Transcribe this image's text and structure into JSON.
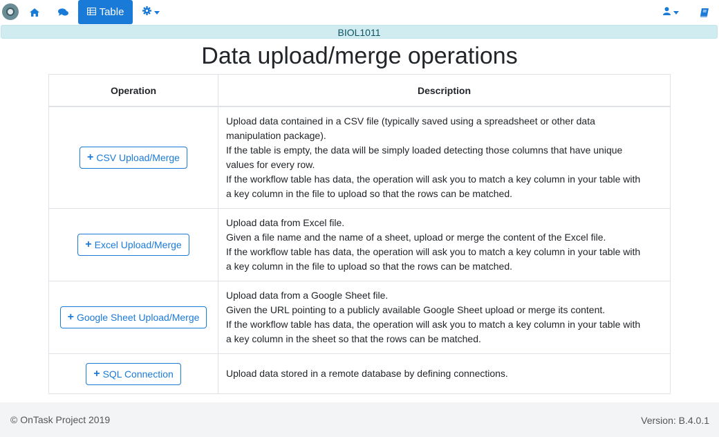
{
  "navbar": {
    "active_tab_label": "Table",
    "icons": [
      "home-icon",
      "comments-icon",
      "table-icon",
      "gear-icon",
      "user-icon",
      "book-icon"
    ]
  },
  "workflow_name": "BIOL1011",
  "page_title": "Data upload/merge operations",
  "table": {
    "headers": {
      "operation": "Operation",
      "description": "Description"
    },
    "rows": [
      {
        "button": "CSV Upload/Merge",
        "lines": [
          "Upload data contained in a CSV file (typically saved using a spreadsheet or other data",
          "manipulation package).",
          "If the table is empty, the data will be simply loaded detecting those columns that have unique",
          "values for every row.",
          "If the workflow table has data, the operation will ask you to match a key column in your table with",
          "a key column in the file to upload so that the rows can be matched."
        ]
      },
      {
        "button": "Excel Upload/Merge",
        "lines": [
          "Upload data from Excel file.",
          "Given a file name and the name of a sheet, upload or merge the content of the Excel file.",
          "If the workflow table has data, the operation will ask you to match a key column in your table with",
          "a key column in the file to upload so that the rows can be matched."
        ]
      },
      {
        "button": "Google Sheet Upload/Merge",
        "lines": [
          "Upload data from a Google Sheet file.",
          "Given the URL pointing to a publicly available Google Sheet upload or merge its content.",
          "If the workflow table has data, the operation will ask you to match a key column in your table with",
          "a key column in the sheet so that the rows can be matched."
        ]
      },
      {
        "button": "SQL Connection",
        "lines": [
          "Upload data stored in a remote database by defining connections."
        ]
      }
    ]
  },
  "footer": {
    "copyright": "© OnTask Project 2019",
    "version": "Version: B.4.0.1"
  },
  "colors": {
    "primary": "#1a7ad8",
    "info_bg": "#d1ecf1",
    "footer_bg": "#f3f4f5"
  }
}
